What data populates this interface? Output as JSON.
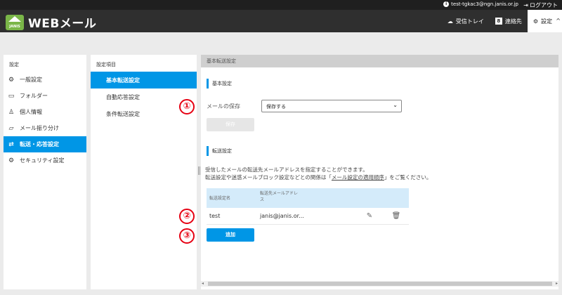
{
  "topbar": {
    "user_email": "test-tgkac3@ngn.janis.or.jp",
    "user_icon": "info-icon",
    "logout_label": "ログアウト",
    "logout_icon": "logout-icon"
  },
  "header": {
    "logo_mark_text": "JANIS",
    "logo_text": "WEBメール",
    "nav": [
      {
        "label": "受信トレイ",
        "icon": "inbox-icon"
      },
      {
        "label": "連絡先",
        "icon": "contacts-icon",
        "glyph": "8"
      },
      {
        "label": "設定",
        "icon": "gear-icon"
      }
    ]
  },
  "sidebar": {
    "title": "設定",
    "items": [
      {
        "label": "一般設定",
        "icon": "gear-icon"
      },
      {
        "label": "フォルダー",
        "icon": "folder-icon"
      },
      {
        "label": "個人情報",
        "icon": "person-icon"
      },
      {
        "label": "メール振り分け",
        "icon": "folder-open-icon"
      },
      {
        "label": "転送・応答設定",
        "icon": "forward-icon"
      },
      {
        "label": "セキュリティ設定",
        "icon": "shield-gear-icon"
      }
    ]
  },
  "subnav": {
    "title": "設定項目",
    "items": [
      {
        "label": "基本転送設定"
      },
      {
        "label": "自動応答設定"
      },
      {
        "label": "条件転送設定"
      }
    ]
  },
  "main": {
    "header": "基本転送設定",
    "basic_section": "基本設定",
    "mail_keep_label": "メールの保存",
    "mail_keep_value": "保存する",
    "save_button": "保存",
    "forward_section": "転送設定",
    "desc_line1": "受信したメールの転送先メールアドレスを指定することができます。",
    "desc_line2_before": "転送設定や迷惑メールブロック設定などとの関係は「",
    "desc_line2_link": "メール設定の適用順序",
    "desc_line2_after": "」をご覧ください。",
    "table": {
      "col_name": "転送設定名",
      "col_addr_1": "転送先メールアドレ",
      "col_addr_2": "ス",
      "rows": [
        {
          "name": "test",
          "address": "janis@janis.or..."
        }
      ]
    },
    "add_button": "追加"
  },
  "callouts": [
    "①",
    "②",
    "③"
  ],
  "colors": {
    "accent": "#0096e6",
    "callout": "#e60012",
    "logo_green": "#7ab648"
  }
}
